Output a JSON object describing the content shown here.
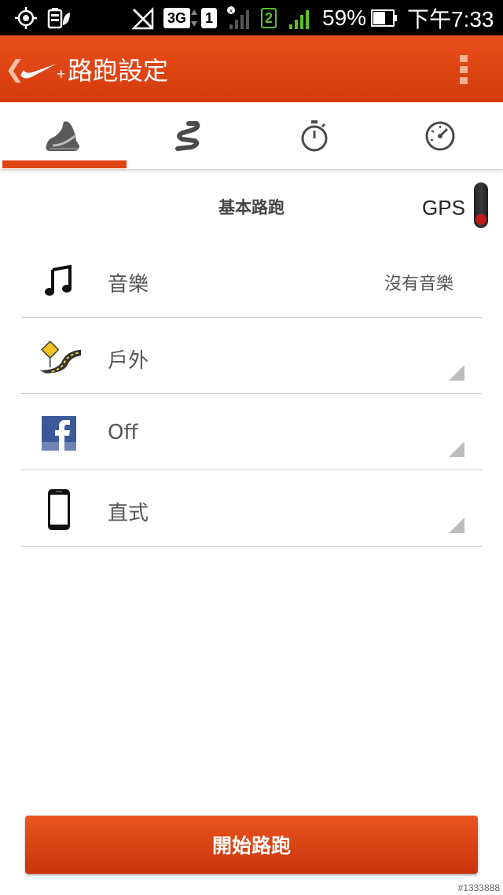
{
  "status_bar": {
    "network_type": "3G",
    "sim1": "1",
    "sim2": "2",
    "battery_percent": "59%",
    "time": "下午7:33"
  },
  "action_bar": {
    "title": "路跑設定"
  },
  "tabs": [
    {
      "icon": "shoe-icon",
      "selected": true
    },
    {
      "icon": "route-icon",
      "selected": false
    },
    {
      "icon": "stopwatch-icon",
      "selected": false
    },
    {
      "icon": "speedometer-icon",
      "selected": false
    }
  ],
  "run_settings": {
    "run_type": "基本路跑",
    "gps_label": "GPS",
    "rows": [
      {
        "icon": "music-note-icon",
        "label": "音樂",
        "value": "沒有音樂"
      },
      {
        "icon": "outdoor-road-icon",
        "label": "戶外"
      },
      {
        "icon": "facebook-icon",
        "label": "Off"
      },
      {
        "icon": "phone-icon",
        "label": "直式"
      }
    ]
  },
  "start_button": {
    "label": "開始路跑"
  },
  "watermark": "#1333888"
}
